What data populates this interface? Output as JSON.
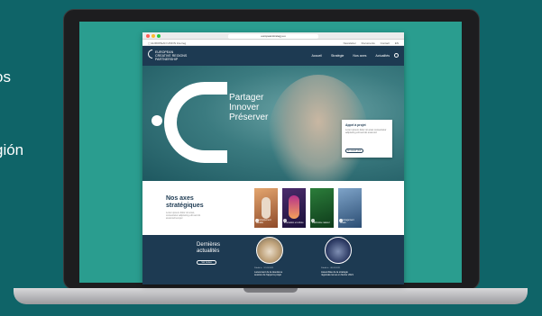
{
  "edge_text": {
    "line1": "os",
    "line2": "gión"
  },
  "browser": {
    "url": "europeanstrategy.eu"
  },
  "topbar": {
    "logos": "▢ EUROPEAN UNION  Interreg",
    "links": [
      "Newsletter",
      "Documents",
      "Contact",
      "EN"
    ]
  },
  "nav": {
    "brand": "EUROPEAN CREATIVE REGIONS PARTNERSHIP",
    "menu": [
      "Accueil",
      "Stratégie",
      "Nos axes",
      "Actualités"
    ]
  },
  "hero": {
    "title_lines": [
      "Partager",
      "Innover",
      "Préserver"
    ],
    "card": {
      "title": "Appel à projet",
      "text": "Lorem ipsum dolor sit amet consectetur adipiscing elit sed do eiusmod",
      "button": "En savoir plus"
    }
  },
  "axes": {
    "title": "Nos axes stratégiques",
    "text": "Lorem ipsum dolor sit amet, consectetur adipiscing elit sed do eiusmod tempor",
    "tiles": [
      {
        "label": "Développement durable"
      },
      {
        "label": "Innovation et culture"
      },
      {
        "label": "Patrimoine naturel"
      },
      {
        "label": "Aménagement urbain"
      }
    ]
  },
  "news": {
    "title": "Dernières actualités",
    "button": "Voir toutes",
    "items": [
      {
        "meta": "Publié le · 12.03.2021",
        "headline": "Lancement de la deuxième session de l'appel à projet"
      },
      {
        "meta": "Publié le · 08.03.2021",
        "headline": "Assemblée de la stratégie régionale tenue en février 2021"
      }
    ]
  }
}
